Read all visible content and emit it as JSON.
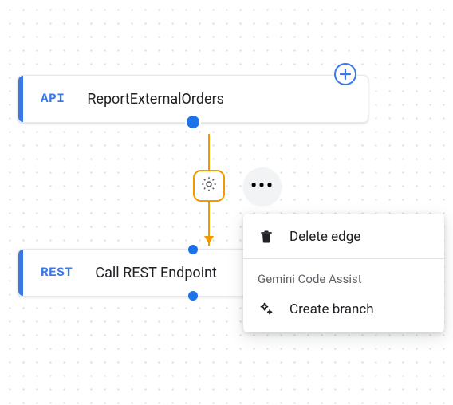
{
  "nodes": {
    "api": {
      "tag": "API",
      "title": "ReportExternalOrders"
    },
    "rest": {
      "tag": "REST",
      "title": "Call REST Endpoint"
    }
  },
  "edge": {
    "gear_icon": "settings"
  },
  "more_button": "•••",
  "menu": {
    "delete_label": "Delete edge",
    "section_label": "Gemini Code Assist",
    "create_branch_label": "Create branch"
  },
  "icons": {
    "plus": "plus",
    "gear": "gear",
    "trash": "trash",
    "sparkle": "sparkle"
  }
}
